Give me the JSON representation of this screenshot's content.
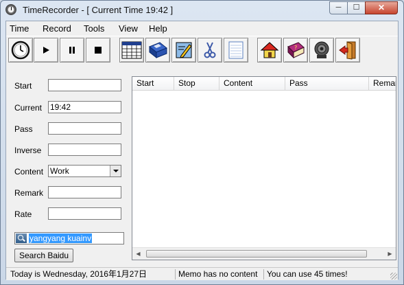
{
  "window": {
    "title": "TimeRecorder - [ Current Time 19:42 ]",
    "min_glyph": "─",
    "max_glyph": "☐",
    "close_glyph": "✕"
  },
  "menu": [
    "Time",
    "Record",
    "Tools",
    "View",
    "Help"
  ],
  "toolbar": {
    "buttons": [
      {
        "icon": "clock-icon"
      },
      {
        "icon": "play-icon"
      },
      {
        "icon": "pause-icon"
      },
      {
        "icon": "stop-icon"
      },
      {
        "icon": "spreadsheet-icon"
      },
      {
        "icon": "floppy-disk-icon"
      },
      {
        "icon": "edit-pencil-icon"
      },
      {
        "icon": "scissors-icon"
      },
      {
        "icon": "notepad-icon"
      },
      {
        "icon": "home-icon"
      },
      {
        "icon": "help-book-icon"
      },
      {
        "icon": "speaker-icon"
      },
      {
        "icon": "exit-door-icon"
      }
    ]
  },
  "form": {
    "start": {
      "label": "Start",
      "value": ""
    },
    "current": {
      "label": "Current",
      "value": "19:42"
    },
    "pass": {
      "label": "Pass",
      "value": ""
    },
    "inverse": {
      "label": "Inverse",
      "value": ""
    },
    "content": {
      "label": "Content",
      "value": "Work"
    },
    "remark": {
      "label": "Remark",
      "value": ""
    },
    "rate": {
      "label": "Rate",
      "value": ""
    }
  },
  "search": {
    "value": "yangyang kuainv",
    "button_label": "Search Baidu"
  },
  "list": {
    "columns": [
      "Start",
      "Stop",
      "Content",
      "Pass",
      "Remar"
    ],
    "rows": []
  },
  "status": {
    "date": "Today is Wednesday, 2016年1月27日",
    "memo": "Memo has no content",
    "uses": "You can use 45 times!"
  },
  "colors": {
    "title_bar": "#dce6f2",
    "close_button": "#c7452f",
    "selection": "#3399ff"
  }
}
